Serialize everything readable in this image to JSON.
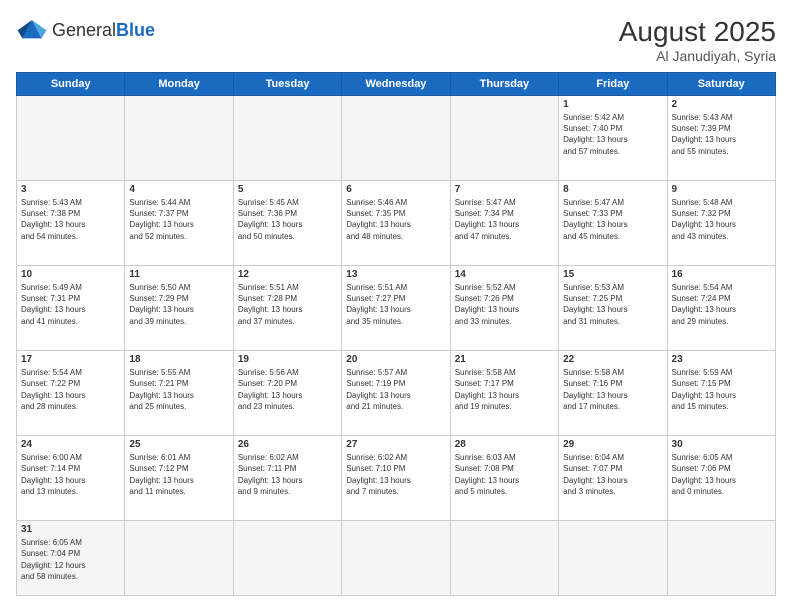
{
  "header": {
    "logo_general": "General",
    "logo_blue": "Blue",
    "month_year": "August 2025",
    "location": "Al Janudiyah, Syria"
  },
  "days_of_week": [
    "Sunday",
    "Monday",
    "Tuesday",
    "Wednesday",
    "Thursday",
    "Friday",
    "Saturday"
  ],
  "weeks": [
    [
      {
        "day": "",
        "info": ""
      },
      {
        "day": "",
        "info": ""
      },
      {
        "day": "",
        "info": ""
      },
      {
        "day": "",
        "info": ""
      },
      {
        "day": "",
        "info": ""
      },
      {
        "day": "1",
        "info": "Sunrise: 5:42 AM\nSunset: 7:40 PM\nDaylight: 13 hours\nand 57 minutes."
      },
      {
        "day": "2",
        "info": "Sunrise: 5:43 AM\nSunset: 7:39 PM\nDaylight: 13 hours\nand 55 minutes."
      }
    ],
    [
      {
        "day": "3",
        "info": "Sunrise: 5:43 AM\nSunset: 7:38 PM\nDaylight: 13 hours\nand 54 minutes."
      },
      {
        "day": "4",
        "info": "Sunrise: 5:44 AM\nSunset: 7:37 PM\nDaylight: 13 hours\nand 52 minutes."
      },
      {
        "day": "5",
        "info": "Sunrise: 5:45 AM\nSunset: 7:36 PM\nDaylight: 13 hours\nand 50 minutes."
      },
      {
        "day": "6",
        "info": "Sunrise: 5:46 AM\nSunset: 7:35 PM\nDaylight: 13 hours\nand 48 minutes."
      },
      {
        "day": "7",
        "info": "Sunrise: 5:47 AM\nSunset: 7:34 PM\nDaylight: 13 hours\nand 47 minutes."
      },
      {
        "day": "8",
        "info": "Sunrise: 5:47 AM\nSunset: 7:33 PM\nDaylight: 13 hours\nand 45 minutes."
      },
      {
        "day": "9",
        "info": "Sunrise: 5:48 AM\nSunset: 7:32 PM\nDaylight: 13 hours\nand 43 minutes."
      }
    ],
    [
      {
        "day": "10",
        "info": "Sunrise: 5:49 AM\nSunset: 7:31 PM\nDaylight: 13 hours\nand 41 minutes."
      },
      {
        "day": "11",
        "info": "Sunrise: 5:50 AM\nSunset: 7:29 PM\nDaylight: 13 hours\nand 39 minutes."
      },
      {
        "day": "12",
        "info": "Sunrise: 5:51 AM\nSunset: 7:28 PM\nDaylight: 13 hours\nand 37 minutes."
      },
      {
        "day": "13",
        "info": "Sunrise: 5:51 AM\nSunset: 7:27 PM\nDaylight: 13 hours\nand 35 minutes."
      },
      {
        "day": "14",
        "info": "Sunrise: 5:52 AM\nSunset: 7:26 PM\nDaylight: 13 hours\nand 33 minutes."
      },
      {
        "day": "15",
        "info": "Sunrise: 5:53 AM\nSunset: 7:25 PM\nDaylight: 13 hours\nand 31 minutes."
      },
      {
        "day": "16",
        "info": "Sunrise: 5:54 AM\nSunset: 7:24 PM\nDaylight: 13 hours\nand 29 minutes."
      }
    ],
    [
      {
        "day": "17",
        "info": "Sunrise: 5:54 AM\nSunset: 7:22 PM\nDaylight: 13 hours\nand 28 minutes."
      },
      {
        "day": "18",
        "info": "Sunrise: 5:55 AM\nSunset: 7:21 PM\nDaylight: 13 hours\nand 25 minutes."
      },
      {
        "day": "19",
        "info": "Sunrise: 5:56 AM\nSunset: 7:20 PM\nDaylight: 13 hours\nand 23 minutes."
      },
      {
        "day": "20",
        "info": "Sunrise: 5:57 AM\nSunset: 7:19 PM\nDaylight: 13 hours\nand 21 minutes."
      },
      {
        "day": "21",
        "info": "Sunrise: 5:58 AM\nSunset: 7:17 PM\nDaylight: 13 hours\nand 19 minutes."
      },
      {
        "day": "22",
        "info": "Sunrise: 5:58 AM\nSunset: 7:16 PM\nDaylight: 13 hours\nand 17 minutes."
      },
      {
        "day": "23",
        "info": "Sunrise: 5:59 AM\nSunset: 7:15 PM\nDaylight: 13 hours\nand 15 minutes."
      }
    ],
    [
      {
        "day": "24",
        "info": "Sunrise: 6:00 AM\nSunset: 7:14 PM\nDaylight: 13 hours\nand 13 minutes."
      },
      {
        "day": "25",
        "info": "Sunrise: 6:01 AM\nSunset: 7:12 PM\nDaylight: 13 hours\nand 11 minutes."
      },
      {
        "day": "26",
        "info": "Sunrise: 6:02 AM\nSunset: 7:11 PM\nDaylight: 13 hours\nand 9 minutes."
      },
      {
        "day": "27",
        "info": "Sunrise: 6:02 AM\nSunset: 7:10 PM\nDaylight: 13 hours\nand 7 minutes."
      },
      {
        "day": "28",
        "info": "Sunrise: 6:03 AM\nSunset: 7:08 PM\nDaylight: 13 hours\nand 5 minutes."
      },
      {
        "day": "29",
        "info": "Sunrise: 6:04 AM\nSunset: 7:07 PM\nDaylight: 13 hours\nand 3 minutes."
      },
      {
        "day": "30",
        "info": "Sunrise: 6:05 AM\nSunset: 7:06 PM\nDaylight: 13 hours\nand 0 minutes."
      }
    ],
    [
      {
        "day": "31",
        "info": "Sunrise: 6:05 AM\nSunset: 7:04 PM\nDaylight: 12 hours\nand 58 minutes."
      },
      {
        "day": "",
        "info": ""
      },
      {
        "day": "",
        "info": ""
      },
      {
        "day": "",
        "info": ""
      },
      {
        "day": "",
        "info": ""
      },
      {
        "day": "",
        "info": ""
      },
      {
        "day": "",
        "info": ""
      }
    ]
  ]
}
